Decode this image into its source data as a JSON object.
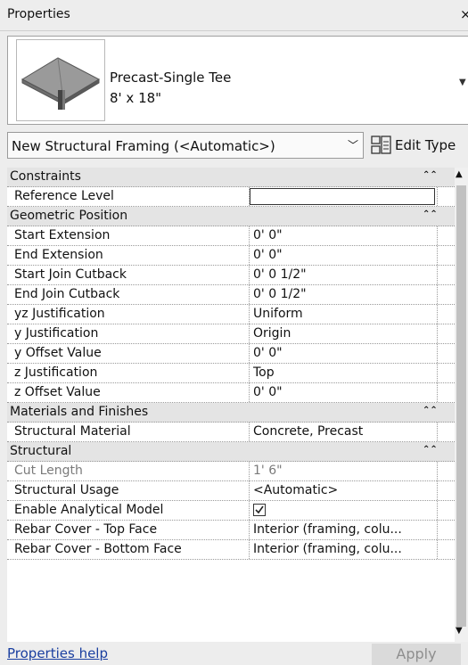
{
  "palette": {
    "title": "Properties",
    "close_icon": "×"
  },
  "type_selector": {
    "family": "Precast-Single Tee",
    "size": "8' x 18\"",
    "dropdown_icon": "chevron-down-icon"
  },
  "instance_selector": {
    "value": "New Structural Framing (<Automatic>)",
    "dropdown_icon": "chevron-down-icon"
  },
  "edit_type": {
    "label": "Edit Type",
    "icon": "edit-type-icon"
  },
  "groups": [
    {
      "title": "Constraints",
      "rows": [
        {
          "name": "Reference Level",
          "value": ""
        }
      ]
    },
    {
      "title": "Geometric Position",
      "rows": [
        {
          "name": "Start Extension",
          "value": "0'  0\""
        },
        {
          "name": "End Extension",
          "value": "0'  0\""
        },
        {
          "name": "Start Join Cutback",
          "value": "0'  0 1/2\""
        },
        {
          "name": "End Join Cutback",
          "value": "0'  0 1/2\""
        },
        {
          "name": "yz Justification",
          "value": "Uniform"
        },
        {
          "name": "y Justification",
          "value": "Origin"
        },
        {
          "name": "y Offset Value",
          "value": "0'  0\""
        },
        {
          "name": "z Justification",
          "value": "Top"
        },
        {
          "name": "z Offset Value",
          "value": "0'  0\""
        }
      ]
    },
    {
      "title": "Materials and Finishes",
      "rows": [
        {
          "name": "Structural Material",
          "value": "Concrete, Precast"
        }
      ]
    },
    {
      "title": "Structural",
      "rows": [
        {
          "name": "Cut Length",
          "value": "1'  6\""
        },
        {
          "name": "Structural Usage",
          "value": "<Automatic>"
        },
        {
          "name": "Enable Analytical Model",
          "checked": true
        },
        {
          "name": "Rebar Cover - Top Face",
          "value": "Interior (framing, colu..."
        },
        {
          "name": "Rebar Cover - Bottom Face",
          "value": "Interior (framing, colu..."
        }
      ]
    }
  ],
  "footer": {
    "help_link": "Properties help",
    "apply_label": "Apply"
  }
}
